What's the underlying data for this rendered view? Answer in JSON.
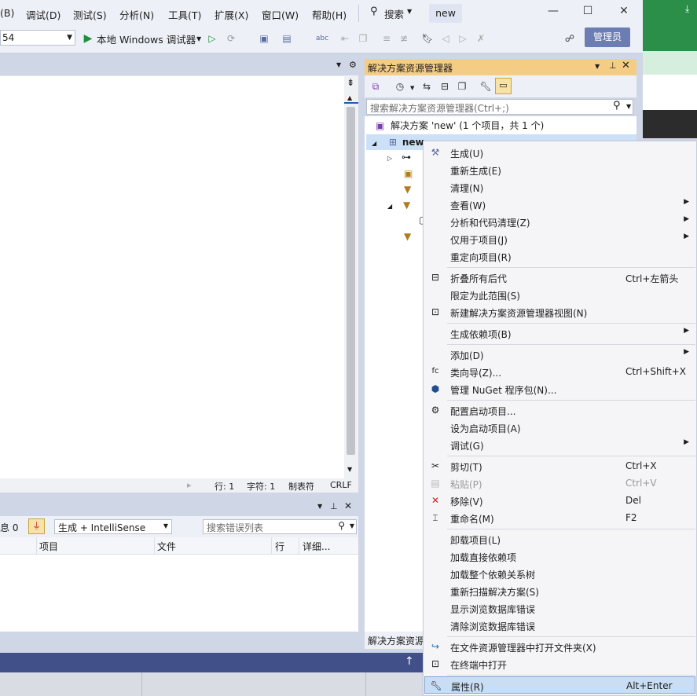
{
  "menubar": {
    "items": [
      "(B)",
      "调试(D)",
      "测试(S)",
      "分析(N)",
      "工具(T)",
      "扩展(X)",
      "窗口(W)",
      "帮助(H)"
    ],
    "search_label": "搜索",
    "solution_name": "new"
  },
  "toolbar": {
    "config_value": "54",
    "run_label": "本地 Windows 调试器",
    "admin_label": "管理员"
  },
  "editor": {
    "status": {
      "line": "行: 1",
      "char": "字符: 1",
      "tab": "制表符",
      "eol": "CRLF"
    }
  },
  "error_list": {
    "messages_label": "息 0",
    "filter_value": "生成 + IntelliSense",
    "search_placeholder": "搜索错误列表",
    "columns": [
      "项目",
      "文件",
      "行",
      "详细..."
    ]
  },
  "solution_explorer": {
    "title": "解决方案资源管理器",
    "search_placeholder": "搜索解决方案资源管理器(Ctrl+;)",
    "solution_row": "解决方案 'new' (1 个项目，共 1 个)",
    "project_row": "new",
    "footer_label": "解决方案资源"
  },
  "context_menu": {
    "items": [
      {
        "label": "生成(U)",
        "shortcut": "",
        "icon": "build-icon"
      },
      {
        "label": "重新生成(E)",
        "shortcut": ""
      },
      {
        "label": "清理(N)",
        "shortcut": ""
      },
      {
        "label": "查看(W)",
        "shortcut": "",
        "submenu": true
      },
      {
        "label": "分析和代码清理(Z)",
        "shortcut": "",
        "submenu": true
      },
      {
        "label": "仅用于项目(J)",
        "shortcut": "",
        "submenu": true
      },
      {
        "label": "重定向项目(R)",
        "shortcut": ""
      },
      {
        "label": "折叠所有后代",
        "shortcut": "Ctrl+左箭头",
        "icon": "collapse-icon"
      },
      {
        "label": "限定为此范围(S)",
        "shortcut": ""
      },
      {
        "label": "新建解决方案资源管理器视图(N)",
        "shortcut": "",
        "icon": "new-view-icon"
      },
      {
        "label": "生成依赖项(B)",
        "shortcut": "",
        "submenu": true
      },
      {
        "label": "添加(D)",
        "shortcut": "",
        "submenu": true
      },
      {
        "label": "类向导(Z)...",
        "shortcut": "Ctrl+Shift+X",
        "icon": "class-wizard-icon"
      },
      {
        "label": "管理 NuGet 程序包(N)...",
        "shortcut": "",
        "icon": "nuget-icon"
      },
      {
        "label": "配置启动项目...",
        "shortcut": "",
        "icon": "gear-icon"
      },
      {
        "label": "设为启动项目(A)",
        "shortcut": ""
      },
      {
        "label": "调试(G)",
        "shortcut": "",
        "submenu": true
      },
      {
        "label": "剪切(T)",
        "shortcut": "Ctrl+X",
        "icon": "cut-icon"
      },
      {
        "label": "粘贴(P)",
        "shortcut": "Ctrl+V",
        "icon": "paste-icon",
        "disabled": true
      },
      {
        "label": "移除(V)",
        "shortcut": "Del",
        "icon": "remove-icon"
      },
      {
        "label": "重命名(M)",
        "shortcut": "F2",
        "icon": "rename-icon"
      },
      {
        "label": "卸载项目(L)",
        "shortcut": ""
      },
      {
        "label": "加载直接依赖项",
        "shortcut": ""
      },
      {
        "label": "加载整个依赖关系树",
        "shortcut": ""
      },
      {
        "label": "重新扫描解决方案(S)",
        "shortcut": ""
      },
      {
        "label": "显示浏览数据库错误",
        "shortcut": ""
      },
      {
        "label": "清除浏览数据库错误",
        "shortcut": ""
      },
      {
        "label": "在文件资源管理器中打开文件夹(X)",
        "shortcut": "",
        "icon": "open-folder-icon"
      },
      {
        "label": "在终端中打开",
        "shortcut": "",
        "icon": "terminal-icon"
      },
      {
        "label": "属性(R)",
        "shortcut": "Alt+Enter",
        "icon": "wrench-icon",
        "highlight": true
      }
    ]
  },
  "colors": {
    "accent": "#42508a",
    "se_title_bg": "#f5cc84",
    "admin_bg": "#6b7db3",
    "highlight": "#c9def5"
  }
}
